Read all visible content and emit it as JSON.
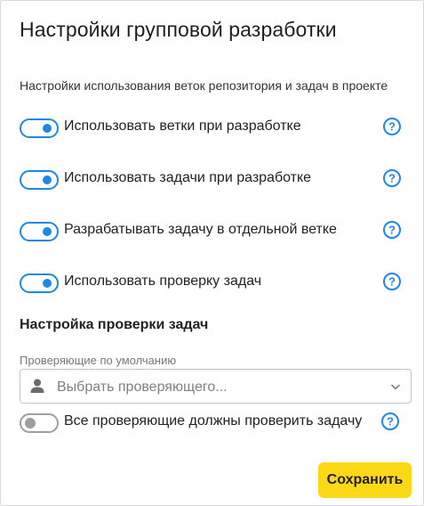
{
  "dialog": {
    "title": "Настройки групповой разработки",
    "subtitle": "Настройки использования веток репозитория и задач в проекте"
  },
  "settings": [
    {
      "label": "Использовать ветки при разработке",
      "enabled": true,
      "help_icon": "question-circle-icon"
    },
    {
      "label": "Использовать задачи при разработке",
      "enabled": true,
      "help_icon": "question-circle-icon"
    },
    {
      "label": "Разрабатывать задачу в отдельной ветке",
      "enabled": true,
      "help_icon": "question-circle-icon"
    },
    {
      "label": "Использовать проверку задач",
      "enabled": true,
      "help_icon": "question-circle-icon"
    }
  ],
  "review": {
    "section_title": "Настройка проверки задач",
    "reviewers_label": "Проверяющие по умолчанию",
    "reviewers_placeholder": "Выбрать проверяющего...",
    "all_must_review": {
      "label": "Все проверяющие должны проверить задачу",
      "enabled": false
    }
  },
  "footer": {
    "save_label": "Сохранить"
  },
  "colors": {
    "accent": "#1e88e5",
    "primary_button": "#fcd916",
    "toggle_off": "#9e9e9e"
  }
}
